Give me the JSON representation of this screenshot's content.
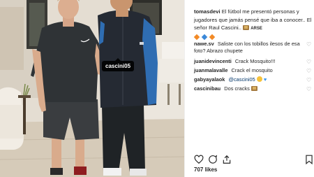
{
  "photo": {
    "tag": "cascini05"
  },
  "caption": {
    "username": "tomasdevi",
    "text": "El fútbol me presentó personas y jugadores que jamás pensé que iba a conocer.. El señor Raul Cascini..",
    "suffix": "ARSE"
  },
  "comments": [
    {
      "username": "nawe.sv",
      "text": "Saliste con los tobillos ilesos de esa foto? Abrazo chupete"
    },
    {
      "username": "juanidevincenti",
      "text": "Crack Mosquito!!!"
    },
    {
      "username": "juanmalavalle",
      "text": "Crack el mosquito"
    },
    {
      "username": "gabyayalaok",
      "mention": "@cascini05"
    },
    {
      "username": "cascinibau",
      "text": "Dos cracks"
    }
  ],
  "likes": "707 likes",
  "colors": {
    "brand_text": "#262626",
    "link": "#003569",
    "tag_bg": "#000000"
  },
  "icons": [
    "heart-icon",
    "comment-icon",
    "share-icon",
    "bookmark-icon"
  ]
}
